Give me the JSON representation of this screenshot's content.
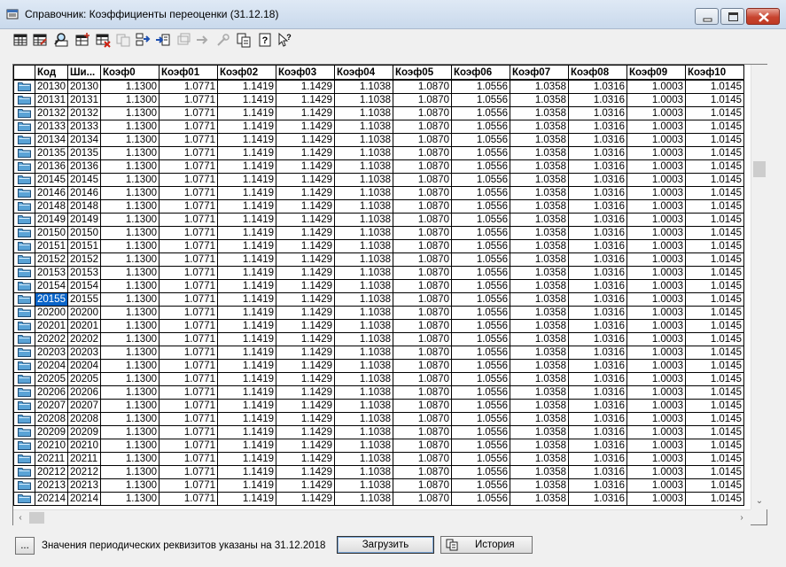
{
  "window": {
    "title": "Справочник: Коэффициенты переоценки (31.12.18)"
  },
  "toolbar": {
    "buttons": [
      {
        "icon": "table-icon"
      },
      {
        "icon": "table-edit-icon"
      },
      {
        "icon": "find-icon"
      },
      {
        "icon": "table-add-icon"
      },
      {
        "icon": "table-delete-icon"
      },
      {
        "icon": "copy-disabled-icon"
      },
      {
        "icon": "move-icon"
      },
      {
        "icon": "import-icon"
      },
      {
        "icon": "refresh-disabled-icon"
      },
      {
        "icon": "arrow-disabled-icon"
      },
      {
        "icon": "tools-disabled-icon"
      },
      {
        "icon": "copy-icon"
      },
      {
        "icon": "help-icon"
      },
      {
        "icon": "context-help-icon"
      }
    ]
  },
  "grid": {
    "columns": [
      "",
      "Код",
      "Ши...",
      "Коэф0",
      "Коэф01",
      "Коэф02",
      "Коэф03",
      "Коэф04",
      "Коэф05",
      "Коэф06",
      "Коэф07",
      "Коэф08",
      "Коэф09",
      "Коэф10"
    ],
    "coefficients": [
      "1.1300",
      "1.0771",
      "1.1419",
      "1.1429",
      "1.1038",
      "1.0870",
      "1.0556",
      "1.0358",
      "1.0316",
      "1.0003",
      "1.0145"
    ],
    "rows": [
      {
        "code": "20130",
        "cipher": "20130"
      },
      {
        "code": "20131",
        "cipher": "20131"
      },
      {
        "code": "20132",
        "cipher": "20132"
      },
      {
        "code": "20133",
        "cipher": "20133"
      },
      {
        "code": "20134",
        "cipher": "20134"
      },
      {
        "code": "20135",
        "cipher": "20135"
      },
      {
        "code": "20136",
        "cipher": "20136"
      },
      {
        "code": "20145",
        "cipher": "20145"
      },
      {
        "code": "20146",
        "cipher": "20146"
      },
      {
        "code": "20148",
        "cipher": "20148"
      },
      {
        "code": "20149",
        "cipher": "20149"
      },
      {
        "code": "20150",
        "cipher": "20150"
      },
      {
        "code": "20151",
        "cipher": "20151"
      },
      {
        "code": "20152",
        "cipher": "20152"
      },
      {
        "code": "20153",
        "cipher": "20153"
      },
      {
        "code": "20154",
        "cipher": "20154"
      },
      {
        "code": "20155",
        "cipher": "20155",
        "selected": true
      },
      {
        "code": "20200",
        "cipher": "20200"
      },
      {
        "code": "20201",
        "cipher": "20201"
      },
      {
        "code": "20202",
        "cipher": "20202"
      },
      {
        "code": "20203",
        "cipher": "20203"
      },
      {
        "code": "20204",
        "cipher": "20204"
      },
      {
        "code": "20205",
        "cipher": "20205"
      },
      {
        "code": "20206",
        "cipher": "20206"
      },
      {
        "code": "20207",
        "cipher": "20207"
      },
      {
        "code": "20208",
        "cipher": "20208"
      },
      {
        "code": "20209",
        "cipher": "20209"
      },
      {
        "code": "20210",
        "cipher": "20210"
      },
      {
        "code": "20211",
        "cipher": "20211"
      },
      {
        "code": "20212",
        "cipher": "20212"
      },
      {
        "code": "20213",
        "cipher": "20213"
      },
      {
        "code": "20214",
        "cipher": "20214"
      }
    ]
  },
  "footer": {
    "dots_label": "...",
    "status_text": "Значения периодических реквизитов указаны на 31.12.2018",
    "load_label": "Загрузить",
    "history_label": "История"
  },
  "colors": {
    "selection": "#0a64c8",
    "folder": "#5aa3d6"
  }
}
